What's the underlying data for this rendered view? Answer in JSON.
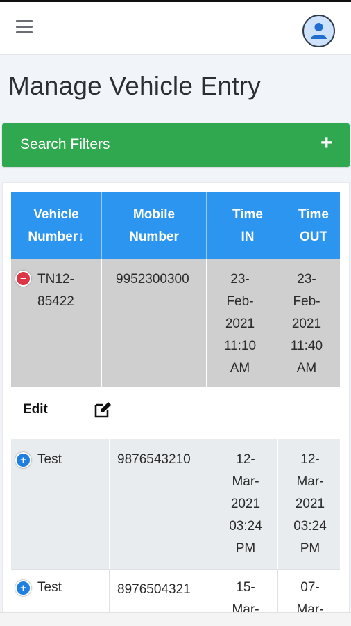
{
  "page": {
    "title": "Manage Vehicle Entry"
  },
  "filters": {
    "label": "Search Filters",
    "toggle_symbol": "+"
  },
  "icons": {
    "menu": "hamburger-menu-icon",
    "user": "user-avatar-icon",
    "edit": "edit-square-icon",
    "collapse": "minus-circle-icon",
    "expand": "plus-circle-icon"
  },
  "colors": {
    "accent": "#2c95f0",
    "filters": "#2fa84f",
    "collapse": "#dc3545",
    "expand": "#1e7fe0"
  },
  "table": {
    "headers": [
      {
        "label": "Vehicle Number↓"
      },
      {
        "label": "Mobile Number"
      },
      {
        "label": "Time IN"
      },
      {
        "label": "Time OUT"
      }
    ],
    "rows": [
      {
        "vehicle": "TN12-85422",
        "mobile": "9952300300",
        "time_in": "23-Feb-2021 11:10 AM",
        "time_out": "23-Feb-2021 11:40 AM",
        "expanded": true
      },
      {
        "vehicle": "Test",
        "mobile": "9876543210",
        "time_in": "12-Mar-2021 03:24 PM",
        "time_out": "12-Mar-2021 03:24 PM",
        "expanded": false
      },
      {
        "vehicle": "Test",
        "mobile": "8976504321",
        "time_in": "15-Mar-",
        "time_out": "07-Mar-",
        "expanded": false
      }
    ],
    "detail": {
      "edit_label": "Edit"
    }
  }
}
